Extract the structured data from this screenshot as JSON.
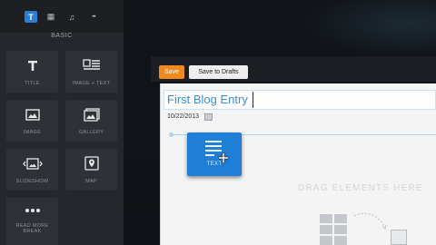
{
  "sidebar": {
    "tabs": [
      {
        "icon": "text-icon",
        "glyph": "T",
        "active": true
      },
      {
        "icon": "layout-icon",
        "glyph": "▦",
        "active": false
      },
      {
        "icon": "music-icon",
        "glyph": "♫",
        "active": false
      },
      {
        "icon": "more-icon",
        "glyph": "•••",
        "active": false
      }
    ],
    "section_label": "BASIC",
    "tiles": [
      {
        "label": "TITLE",
        "icon": "title-icon"
      },
      {
        "label": "IMAGE + TEXT",
        "icon": "image-text-icon"
      },
      {
        "label": "IMAGE",
        "icon": "image-icon"
      },
      {
        "label": "GALLERY",
        "icon": "gallery-icon"
      },
      {
        "label": "SLIDESHOW",
        "icon": "slideshow-icon"
      },
      {
        "label": "MAP",
        "icon": "map-icon"
      },
      {
        "label": "READ MORE BREAK",
        "icon": "more-dots-icon"
      }
    ]
  },
  "toolbar": {
    "save_label": "Save",
    "drafts_label": "Save to Drafts"
  },
  "editor": {
    "title": "First Blog Entry",
    "date": "10/22/2013",
    "drag_hint": "DRAG ELEMENTS HERE"
  },
  "dragged_element": {
    "label": "TEXT",
    "icon": "text-lines-icon"
  },
  "colors": {
    "accent": "#2a7fd4",
    "save": "#f08a1c",
    "title": "#3d8ed1",
    "panel": "#24272b"
  }
}
